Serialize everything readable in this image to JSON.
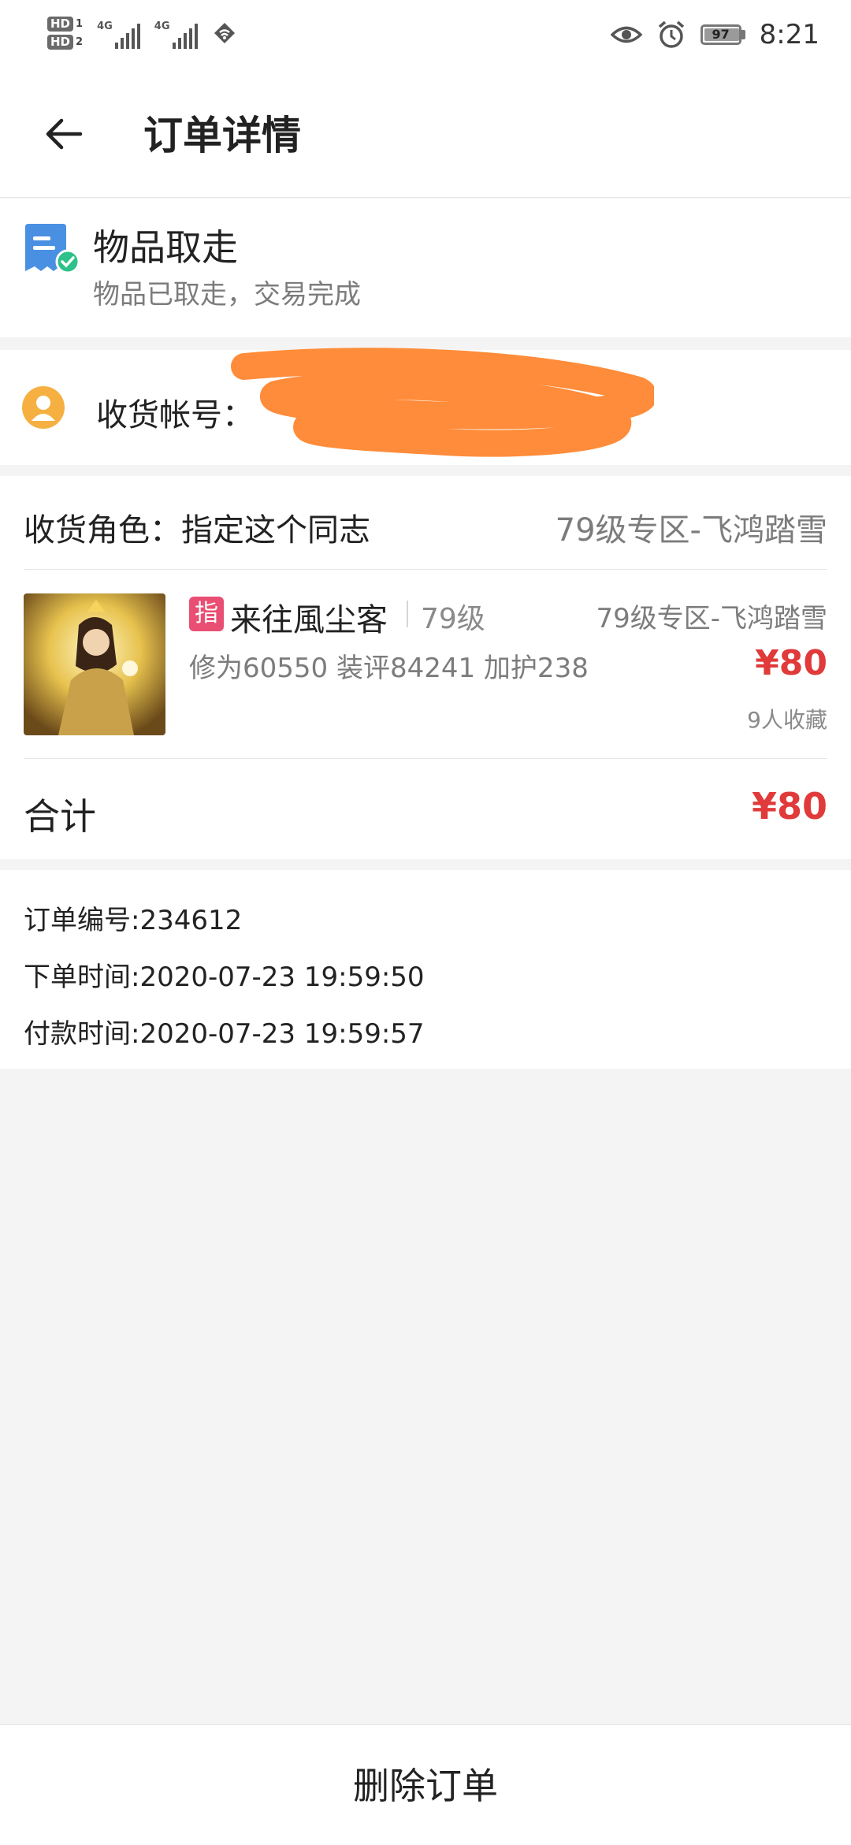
{
  "status_bar": {
    "hd1": "HD",
    "hd1_sub": "1",
    "hd2": "HD",
    "hd2_sub": "2",
    "net1": "4G",
    "net2": "4G",
    "battery": "97",
    "time": "8:21"
  },
  "header": {
    "title": "订单详情"
  },
  "order_status": {
    "title": "物品取走",
    "subtitle": "物品已取走，交易完成"
  },
  "account": {
    "label": "收货帐号："
  },
  "role": {
    "label": "收货角色：指定这个同志",
    "zone": "79级专区-飞鸿踏雪"
  },
  "item": {
    "badge": "指",
    "name": "来往風尘客",
    "level": "79级",
    "zone": "79级专区-飞鸿踏雪",
    "stats": "修为60550 装评84241 加护238",
    "price": "¥80",
    "favorites": "9人收藏"
  },
  "total": {
    "label": "合计",
    "price": "¥80"
  },
  "info": {
    "order_no": "订单编号:234612",
    "order_time": "下单时间:2020-07-23 19:59:50",
    "pay_time": "付款时间:2020-07-23 19:59:57"
  },
  "actions": {
    "delete": "删除订单"
  },
  "colors": {
    "price": "#e03a3a",
    "badge": "#e94e73",
    "redaction": "#ff8c3a",
    "avatar": "#f5b041"
  },
  "battery_level": 0.97
}
